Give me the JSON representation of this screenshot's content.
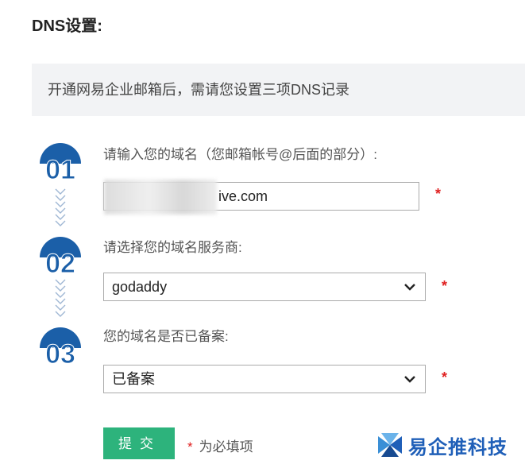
{
  "page": {
    "title": "DNS设置:",
    "notice": "开通网易企业邮箱后，需请您设置三项DNS记录"
  },
  "steps": [
    {
      "number": "01",
      "label": "请输入您的域名（您邮箱帐号@后面的部分）:",
      "value": "ive.com"
    },
    {
      "number": "02",
      "label": "请选择您的域名服务商:",
      "selected": "godaddy"
    },
    {
      "number": "03",
      "label": "您的域名是否已备案:",
      "selected": "已备案"
    }
  ],
  "required_mark": "*",
  "submit_label": "提交",
  "required_note": "为必填项",
  "watermark": {
    "text": "易企推科技"
  },
  "colors": {
    "badge": "#1b5fa8",
    "submit": "#2db37c",
    "asterisk": "#e02020",
    "notice_bg": "#f2f3f5"
  }
}
